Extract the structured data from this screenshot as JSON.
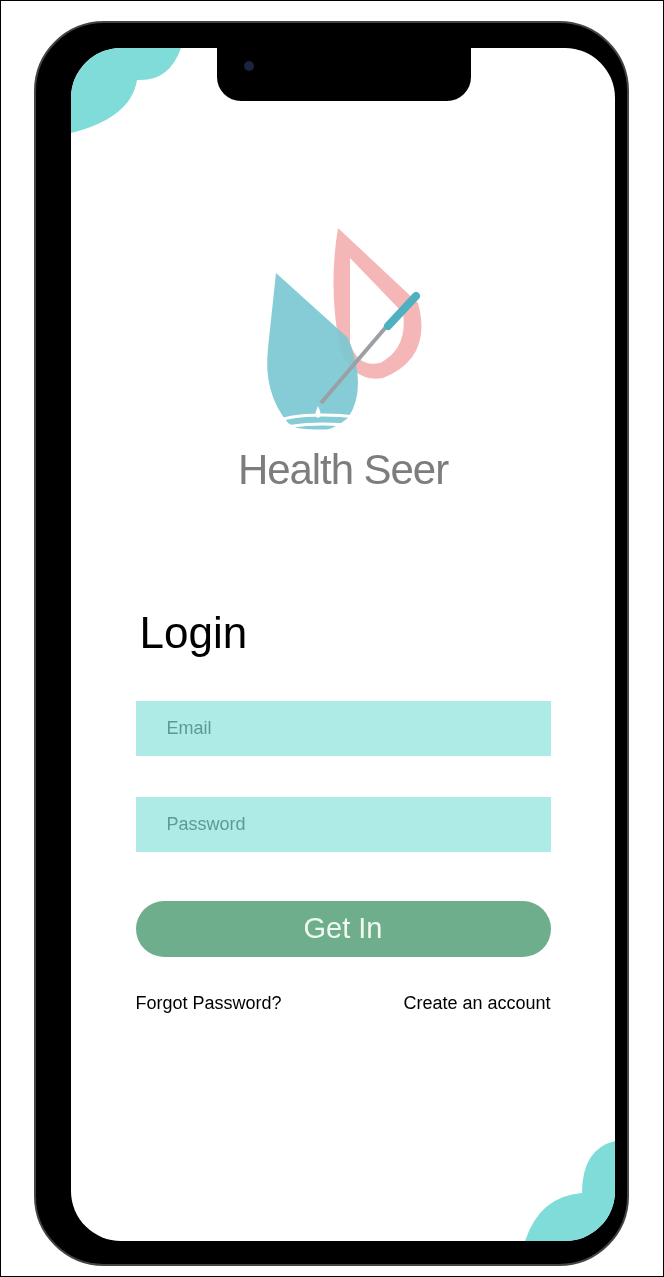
{
  "app": {
    "name": "Health Seer"
  },
  "form": {
    "title": "Login",
    "fields": [
      {
        "placeholder": "Email"
      },
      {
        "placeholder": "Password"
      }
    ],
    "submit": "Get In",
    "links": [
      "Forgot Password?",
      "Create an account"
    ]
  }
}
